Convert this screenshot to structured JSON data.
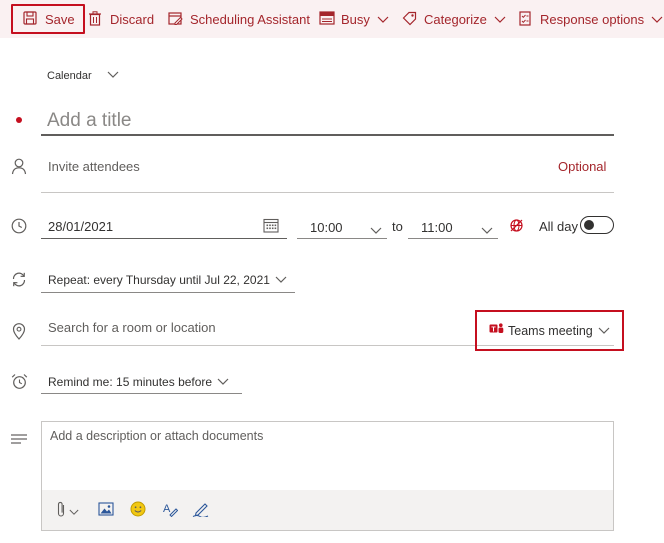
{
  "toolbar": {
    "save_label": "Save",
    "discard_label": "Discard",
    "scheduling_label": "Scheduling Assistant",
    "busy_label": "Busy",
    "categorize_label": "Categorize",
    "response_label": "Response options"
  },
  "form": {
    "calendar_label": "Calendar",
    "title_placeholder": "Add a title",
    "attendees_placeholder": "Invite attendees",
    "optional_label": "Optional",
    "start_date": "28/01/2021",
    "start_time": "10:00",
    "to_label": "to",
    "end_time": "11:00",
    "all_day_label": "All day",
    "all_day_on": false,
    "repeat_label": "Repeat:",
    "repeat_value": "every Thursday until Jul 22, 2021",
    "location_placeholder": "Search for a room or location",
    "teams_label": "Teams meeting",
    "remind_label": "Remind me:",
    "remind_value": "15 minutes before",
    "description_placeholder": "Add a description or attach documents"
  },
  "colors": {
    "accent": "#a4262c",
    "toolbar_bg": "#faf1f2",
    "highlight_box": "#c50f1f"
  }
}
